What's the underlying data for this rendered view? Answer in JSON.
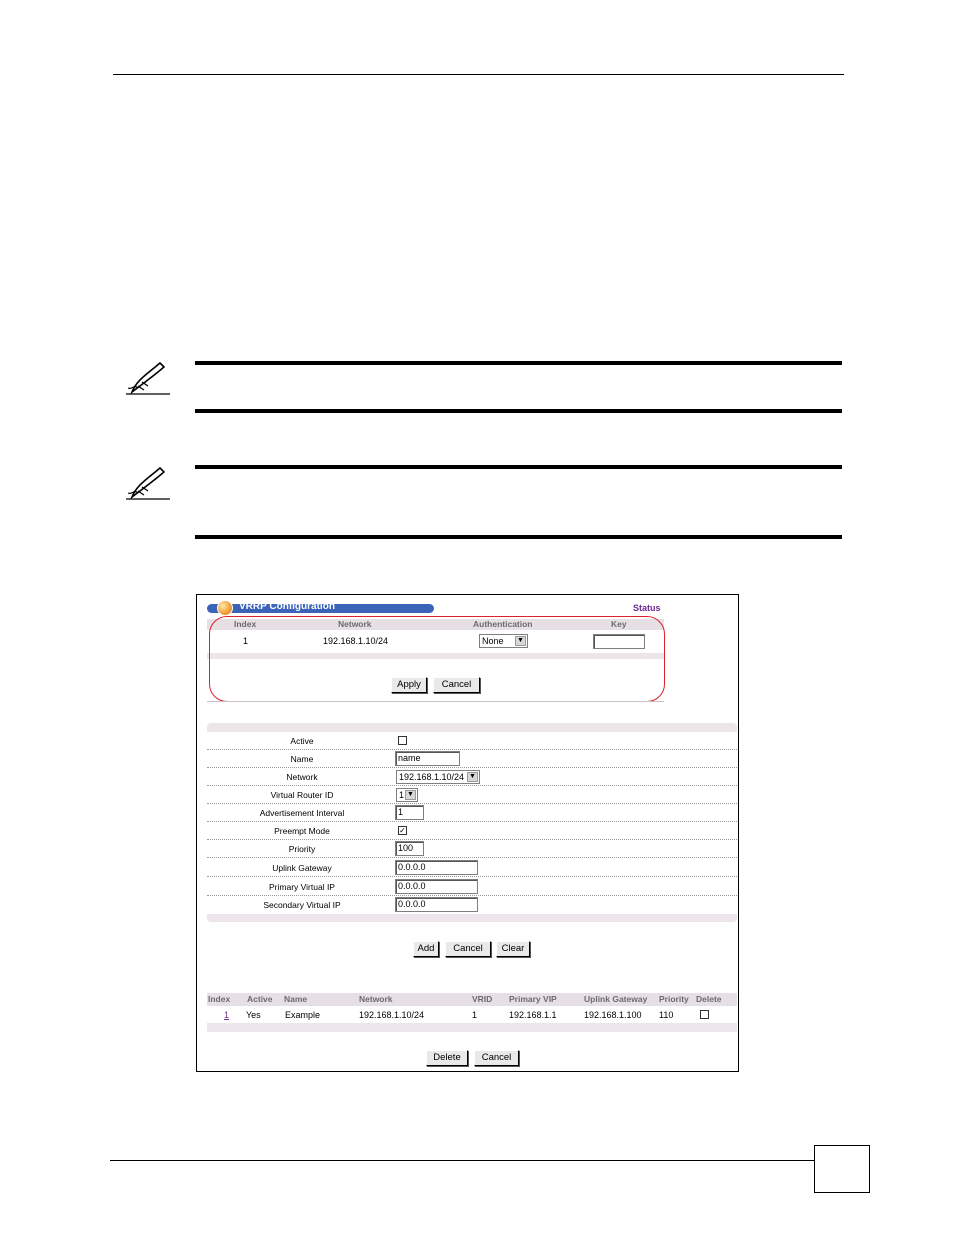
{
  "vrrp_config": {
    "title": "VRRP Configuration",
    "status_link": "Status",
    "network_table": {
      "columns": [
        "Index",
        "Network",
        "Authentication",
        "Key"
      ],
      "rows": [
        {
          "index": "1",
          "network": "192.168.1.10/24",
          "authentication": "None",
          "key": ""
        }
      ]
    },
    "apply_label": "Apply",
    "cancel_label": "Cancel"
  },
  "form": {
    "fields": {
      "active": {
        "label": "Active",
        "checked": false
      },
      "name": {
        "label": "Name",
        "value": "name"
      },
      "network": {
        "label": "Network",
        "value": "192.168.1.10/24"
      },
      "vrid": {
        "label": "Virtual Router ID",
        "value": "1"
      },
      "adv_interval": {
        "label": "Advertisement Interval",
        "value": "1"
      },
      "preempt": {
        "label": "Preempt Mode",
        "checked": true
      },
      "priority": {
        "label": "Priority",
        "value": "100"
      },
      "uplink": {
        "label": "Uplink Gateway",
        "value": "0.0.0.0"
      },
      "primary_vip": {
        "label": "Primary Virtual IP",
        "value": "0.0.0.0"
      },
      "secondary_vip": {
        "label": "Secondary Virtual IP",
        "value": "0.0.0.0"
      }
    },
    "add_label": "Add",
    "cancel_label": "Cancel",
    "clear_label": "Clear"
  },
  "summary": {
    "columns": [
      "Index",
      "Active",
      "Name",
      "Network",
      "VRID",
      "Primary VIP",
      "Uplink Gateway",
      "Priority",
      "Delete"
    ],
    "rows": [
      {
        "index": "1",
        "active": "Yes",
        "name": "Example",
        "network": "192.168.1.10/24",
        "vrid": "1",
        "primary_vip": "192.168.1.1",
        "uplink": "192.168.1.100",
        "priority": "110",
        "delete": false
      }
    ],
    "delete_label": "Delete",
    "cancel_label": "Cancel"
  }
}
